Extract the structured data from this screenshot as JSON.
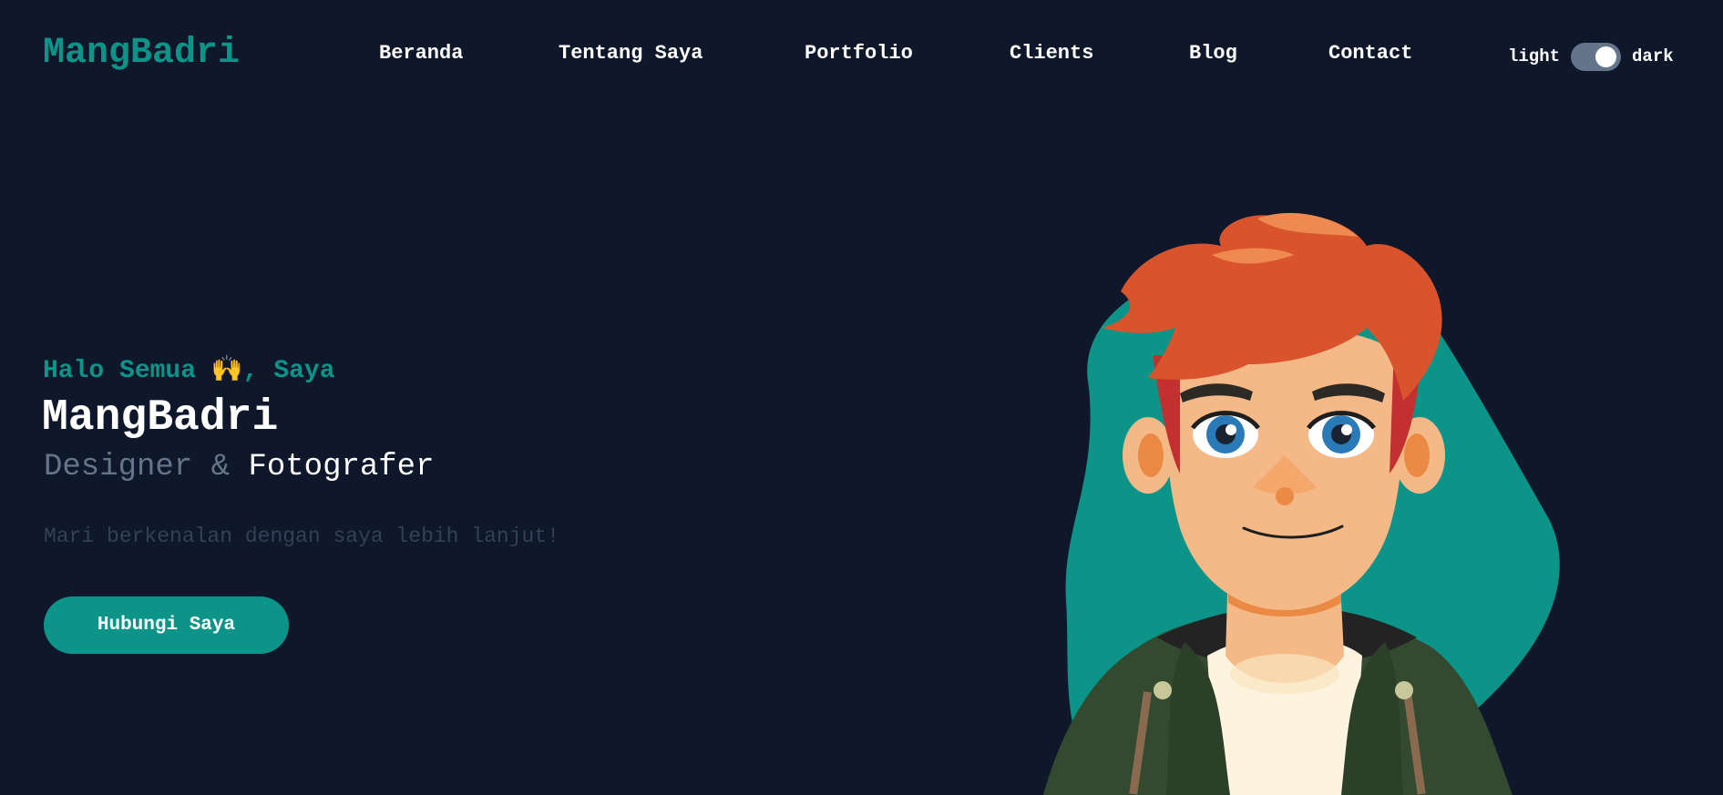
{
  "nav": {
    "brand": "MangBadri",
    "links": [
      "Beranda",
      "Tentang Saya",
      "Portfolio",
      "Clients",
      "Blog",
      "Contact"
    ],
    "theme_toggle": {
      "light_label": "light",
      "dark_label": "dark",
      "state": "dark"
    }
  },
  "hero": {
    "greeting_prefix": "Halo Semua ",
    "greeting_emoji": "🙌",
    "greeting_suffix": ", Saya",
    "name": "MangBadri",
    "role_primary": "Designer",
    "role_separator": " & ",
    "role_secondary": "Fotografer",
    "tagline": "Mari berkenalan dengan saya lebih lanjut!",
    "cta_label": "Hubungi Saya"
  },
  "colors": {
    "background": "#0f172a",
    "accent": "#0d9488",
    "muted": "#64748b",
    "tagline": "#334155"
  },
  "illustration": {
    "icon": "avatar-illustration"
  }
}
